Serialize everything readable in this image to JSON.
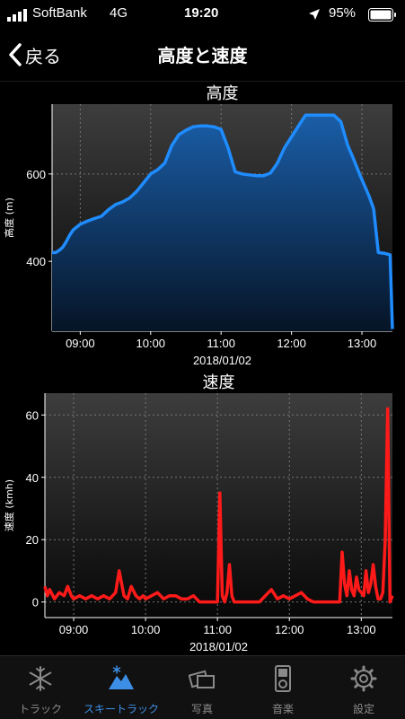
{
  "status": {
    "carrier": "SoftBank",
    "network": "4G",
    "time": "19:20",
    "battery": "95%"
  },
  "nav": {
    "back_label": "戻る",
    "title": "高度と速度"
  },
  "colors": {
    "altitude_line": "#1f8cff",
    "speed_line": "#ff1a1a",
    "tab_active": "#3d8fe6",
    "tab_inactive": "#8a8a8a"
  },
  "chart_data": [
    {
      "type": "area",
      "title": "高度",
      "xlabel": "2018/01/02",
      "ylabel": "高度 (m)",
      "xticks": [
        "09:00",
        "10:00",
        "11:00",
        "12:00",
        "13:00"
      ],
      "yticks": [
        "400",
        "600"
      ],
      "xlim": [
        "08:36",
        "13:26"
      ],
      "ylim": [
        240,
        760
      ],
      "grid": true,
      "series": [
        {
          "x": [
            "08:36",
            "08:39",
            "08:42",
            "08:45",
            "08:48",
            "08:51",
            "08:54",
            "09:00",
            "09:06",
            "09:12",
            "09:18",
            "09:24",
            "09:30",
            "09:36",
            "09:42",
            "09:48",
            "09:54",
            "10:00",
            "10:06",
            "10:12",
            "10:18",
            "10:24",
            "10:30",
            "10:36",
            "10:42",
            "10:48",
            "10:54",
            "11:00",
            "11:06",
            "11:12",
            "11:18",
            "11:24",
            "11:30",
            "11:36",
            "11:42",
            "11:48",
            "11:54",
            "12:00",
            "12:06",
            "12:12",
            "12:18",
            "12:24",
            "12:30",
            "12:36",
            "12:42",
            "12:48",
            "12:52",
            "12:58",
            "13:02",
            "13:06",
            "13:10",
            "13:14",
            "13:20",
            "13:24",
            "13:26"
          ],
          "values": [
            420,
            420,
            425,
            432,
            445,
            460,
            472,
            485,
            492,
            498,
            503,
            518,
            530,
            536,
            545,
            560,
            580,
            600,
            610,
            625,
            665,
            690,
            700,
            708,
            710,
            710,
            708,
            702,
            660,
            605,
            600,
            598,
            596,
            596,
            602,
            625,
            660,
            685,
            710,
            735,
            735,
            735,
            735,
            735,
            720,
            665,
            640,
            600,
            575,
            550,
            520,
            420,
            418,
            415,
            245
          ]
        }
      ]
    },
    {
      "type": "line",
      "title": "速度",
      "xlabel": "2018/01/02",
      "ylabel": "速度 (kmh)",
      "xticks": [
        "09:00",
        "10:00",
        "11:00",
        "12:00",
        "13:00"
      ],
      "yticks": [
        "0",
        "20",
        "40",
        "60"
      ],
      "xlim": [
        "08:36",
        "13:26"
      ],
      "ylim": [
        -5,
        67
      ],
      "grid": true,
      "series": [
        {
          "x": [
            "08:36",
            "08:38",
            "08:40",
            "08:44",
            "08:48",
            "08:52",
            "08:55",
            "08:58",
            "09:00",
            "09:05",
            "09:10",
            "09:15",
            "09:20",
            "09:25",
            "09:30",
            "09:35",
            "09:38",
            "09:42",
            "09:45",
            "09:48",
            "09:52",
            "09:55",
            "09:58",
            "10:00",
            "10:05",
            "10:10",
            "10:15",
            "10:20",
            "10:25",
            "10:30",
            "10:35",
            "10:40",
            "10:45",
            "10:50",
            "10:55",
            "11:00",
            "11:02",
            "11:04",
            "11:06",
            "11:08",
            "11:10",
            "11:12",
            "11:14",
            "11:17",
            "11:20",
            "11:25",
            "11:30",
            "11:35",
            "11:40",
            "11:45",
            "11:50",
            "11:55",
            "12:00",
            "12:05",
            "12:10",
            "12:15",
            "12:20",
            "12:25",
            "12:30",
            "12:35",
            "12:40",
            "12:42",
            "12:44",
            "12:46",
            "12:48",
            "12:50",
            "12:52",
            "12:54",
            "12:56",
            "12:58",
            "13:00",
            "13:02",
            "13:04",
            "13:06",
            "13:08",
            "13:10",
            "13:12",
            "13:14",
            "13:16",
            "13:18",
            "13:20",
            "13:22",
            "13:24",
            "13:26"
          ],
          "values": [
            5,
            2,
            4,
            1,
            3,
            2,
            5,
            2,
            1,
            2,
            1,
            2,
            1,
            2,
            1,
            3,
            10,
            2,
            1,
            5,
            2,
            1,
            2,
            1,
            2,
            3,
            1,
            2,
            2,
            1,
            1,
            2,
            0,
            0,
            0,
            0,
            35,
            2,
            0,
            3,
            12,
            2,
            0,
            0,
            0,
            0,
            0,
            0,
            2,
            4,
            1,
            2,
            1,
            2,
            3,
            1,
            0,
            0,
            0,
            0,
            0,
            0,
            16,
            6,
            2,
            10,
            4,
            2,
            8,
            4,
            3,
            2,
            10,
            3,
            6,
            12,
            5,
            1,
            1,
            3,
            20,
            62,
            0,
            2
          ]
        }
      ]
    }
  ],
  "tabs": [
    {
      "label": "トラック",
      "icon": "snowflake-icon"
    },
    {
      "label": "スキートラック",
      "icon": "mountain-icon"
    },
    {
      "label": "写真",
      "icon": "photos-icon"
    },
    {
      "label": "音楽",
      "icon": "music-player-icon"
    },
    {
      "label": "設定",
      "icon": "gear-icon"
    }
  ]
}
